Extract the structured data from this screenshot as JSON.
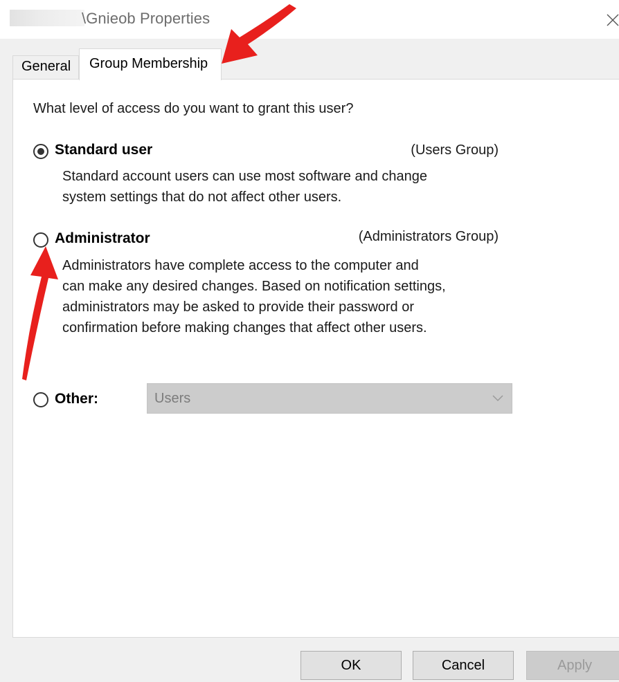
{
  "window": {
    "title": "\\Gnieob Properties",
    "close_icon": "close-icon"
  },
  "tabs": [
    {
      "label": "General",
      "active": false
    },
    {
      "label": "Group Membership",
      "active": true
    }
  ],
  "content": {
    "question": "What level of access do you want to grant this user?",
    "options": [
      {
        "label": "Standard user",
        "group": "(Users Group)",
        "checked": true,
        "description": [
          "Standard account users can use most software and change",
          "system settings that do not affect other users."
        ]
      },
      {
        "label": "Administrator",
        "group": "(Administrators Group)",
        "checked": false,
        "description": [
          "Administrators have complete access to the computer and",
          "can make any desired changes. Based on notification settings,",
          "administrators may be asked to provide their password or",
          "confirmation before making changes that affect other users."
        ]
      },
      {
        "label": "Other:",
        "checked": false,
        "select_value": "Users",
        "select_disabled": true
      }
    ]
  },
  "buttons": {
    "ok": "OK",
    "cancel": "Cancel",
    "apply": "Apply",
    "apply_disabled": true
  },
  "annotation_color": "#e8201d"
}
